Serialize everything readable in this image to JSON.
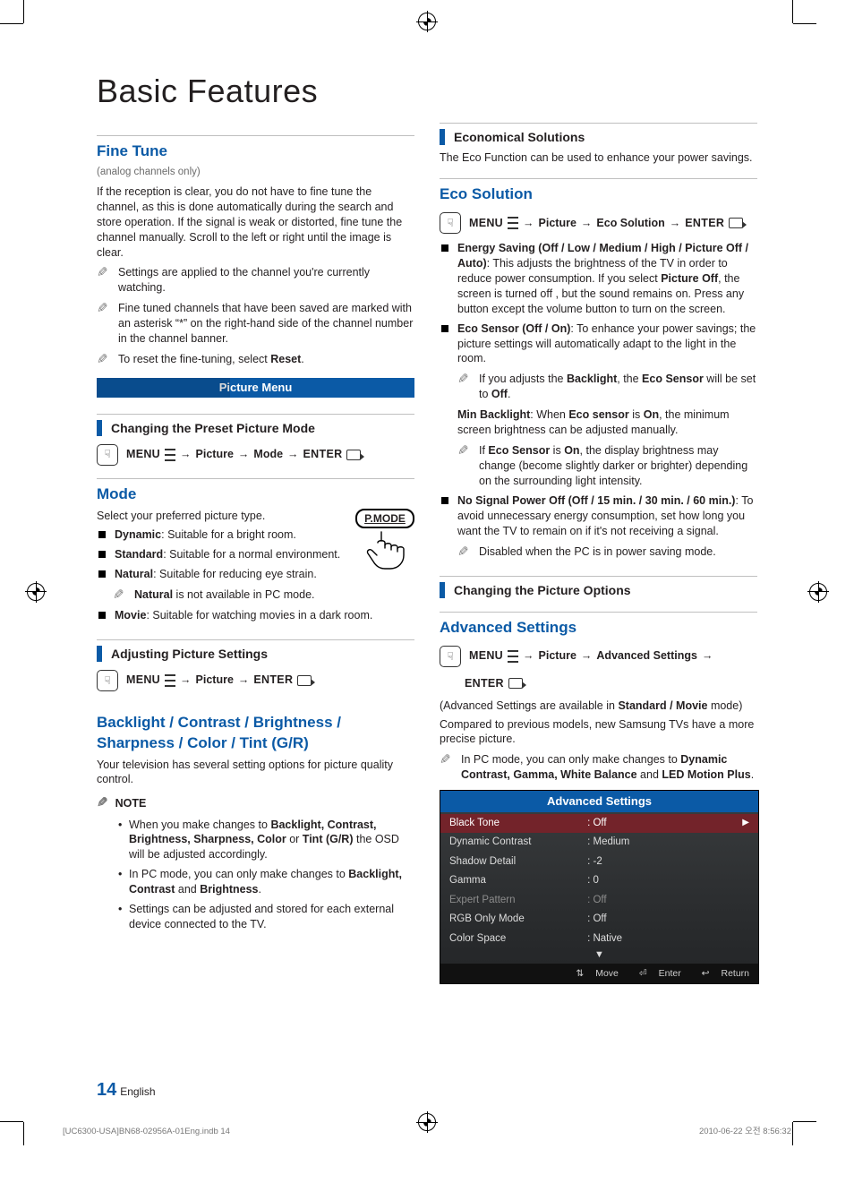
{
  "page": {
    "title": "Basic Features",
    "number": "14",
    "lang": "English"
  },
  "print": {
    "left": "[UC6300-USA]BN68-02956A-01Eng.indb   14",
    "right": "2010-06-22   오전 8:56:32"
  },
  "left": {
    "fineTune": {
      "heading": "Fine Tune",
      "sub": "(analog channels only)",
      "body": "If the reception is clear, you do not have to fine tune the channel, as this is done automatically during the search and store operation. If the signal is weak or distorted, fine tune the channel manually. Scroll to the left or right until the image is clear.",
      "tips": [
        "Settings are applied to the channel you're currently watching.",
        "Fine tuned channels that have been saved are marked with an asterisk “*” on the right-hand side of the channel number in the channel banner.",
        "To reset the fine-tuning, select "
      ],
      "resetWord": "Reset"
    },
    "pictureBar": "Picture Menu",
    "changePreset": {
      "heading": "Changing the Preset Picture Mode",
      "menuPrefix": "MENU",
      "menuMid1": " → ",
      "menuPicture": "Picture",
      "menuMid2": " → ",
      "menuMode": "Mode",
      "menuMid3": " → ",
      "menuEnter": "ENTER"
    },
    "mode": {
      "heading": "Mode",
      "intro": "Select your preferred picture type.",
      "pmodeLabel": "P.MODE",
      "items": {
        "dynamic": {
          "name": "Dynamic",
          "desc": "Suitable for a bright room."
        },
        "standard": {
          "name": "Standard",
          "desc": "Suitable for a normal environment."
        },
        "natural": {
          "name": "Natural",
          "desc": "Suitable for reducing eye strain."
        },
        "naturalNoteA": "Natural",
        "naturalNoteB": " is not available in PC mode.",
        "movie": {
          "name": "Movie",
          "desc": "Suitable for watching movies in a dark room."
        }
      }
    },
    "adjust": {
      "heading": "Adjusting Picture Settings",
      "menuPrefix": "MENU",
      "menuPicture": "Picture",
      "menuEnter": "ENTER"
    },
    "sixParams": {
      "heading": "Backlight / Contrast / Brightness / Sharpness / Color / Tint (G/R)",
      "body": "Your television has several setting options for picture quality control.",
      "noteWord": "NOTE",
      "notes": {
        "n1a": "When you make changes to ",
        "n1b": "Backlight, Contrast, Brightness, Sharpness, Color",
        "n1c": " or ",
        "n1d": "Tint (G/R)",
        "n1e": " the OSD will be adjusted accordingly.",
        "n2a": "In PC mode, you can only make changes to ",
        "n2b": "Backlight, Contrast",
        "n2c": " and ",
        "n2d": "Brightness",
        "n2e": ".",
        "n3": "Settings can be adjusted and stored for each external device connected to the TV."
      }
    }
  },
  "right": {
    "econ": {
      "heading": "Economical Solutions",
      "body": "The Eco Function can be used to enhance your power savings."
    },
    "eco": {
      "heading": "Eco Solution",
      "menuPrefix": "MENU",
      "menuPicture": "Picture",
      "menuEco": "Eco Solution",
      "menuEnter": "ENTER",
      "energy": {
        "title": "Energy Saving (Off / Low / Medium / High / Picture Off / Auto)",
        "body1": ": This adjusts the brightness of the TV in order to reduce power consumption. If you select ",
        "pictureOff": "Picture Off",
        "body2": ", the screen is turned off , but the sound remains on. Press any button except the volume button to turn on the screen."
      },
      "sensor": {
        "title": "Eco Sensor (Off / On)",
        "body": ": To enhance your power savings; the picture settings will automatically adapt to the light in the room.",
        "tipA": "If you adjusts the ",
        "tipB": "Backlight",
        "tipC": ", the ",
        "tipD": "Eco Sensor",
        "tipE": " will be set to ",
        "tipF": "Off",
        "tipG": ".",
        "minA": "Min Backlight",
        "minB": ": When ",
        "minC": "Eco sensor",
        "minD": " is ",
        "minE": "On",
        "minF": ", the minimum screen brightness can be adjusted manually.",
        "tip2A": "If ",
        "tip2B": "Eco Sensor",
        "tip2C": " is ",
        "tip2D": "On",
        "tip2E": ", the display brightness may change (become slightly darker or brighter) depending on the surrounding light intensity."
      },
      "nosignal": {
        "title": "No Signal Power Off (Off / 15 min. / 30 min. / 60 min.)",
        "body": ": To avoid unnecessary energy consumption, set how long you want the TV to remain on if it's not receiving a signal.",
        "tip": "Disabled when the PC is in power saving mode."
      }
    },
    "changeOpts": {
      "heading": "Changing the Picture Options"
    },
    "adv": {
      "heading": "Advanced Settings",
      "menuPrefix": "MENU",
      "menuPicture": "Picture",
      "menuAdv": "Advanced Settings",
      "menuEnter": "ENTER",
      "line1a": "(Advanced Settings are available in ",
      "line1b": "Standard / Movie",
      "line1c": " mode)",
      "line2": "Compared to previous models, new Samsung TVs have a more precise picture.",
      "tipA": "In PC mode, you can only make changes to ",
      "tipB": "Dynamic Contrast, Gamma, White Balance",
      "tipC": " and ",
      "tipD": "LED Motion Plus",
      "tipE": "."
    },
    "osd": {
      "title": "Advanced Settings",
      "rows": [
        {
          "k": "Black Tone",
          "v": ": Off",
          "sel": true
        },
        {
          "k": "Dynamic Contrast",
          "v": ": Medium"
        },
        {
          "k": "Shadow Detail",
          "v": ": -2"
        },
        {
          "k": "Gamma",
          "v": ": 0"
        },
        {
          "k": "Expert Pattern",
          "v": ": Off",
          "dim": true
        },
        {
          "k": "RGB Only Mode",
          "v": ": Off"
        },
        {
          "k": "Color Space",
          "v": ": Native"
        }
      ],
      "more": "▼",
      "hints": {
        "move": "Move",
        "enter": "Enter",
        "ret": "Return"
      }
    }
  }
}
